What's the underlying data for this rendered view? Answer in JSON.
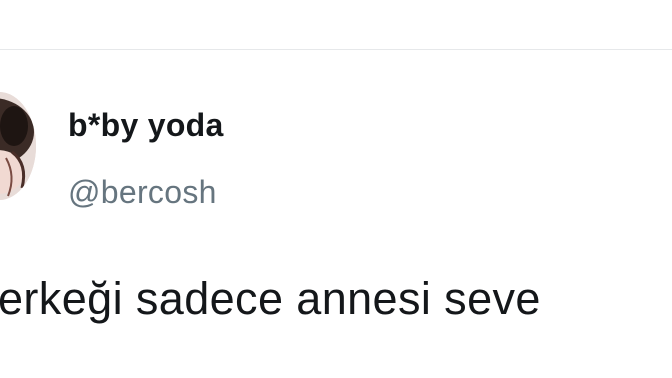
{
  "user": {
    "display_name": "b*by yoda",
    "handle": "@bercosh",
    "avatar_icon": "profile-photo"
  },
  "tweet": {
    "text": "erkeği sadece annesi seve"
  },
  "colors": {
    "text_primary": "#14171a",
    "text_secondary": "#66757f",
    "divider": "#e6e8ea",
    "background": "#ffffff"
  }
}
